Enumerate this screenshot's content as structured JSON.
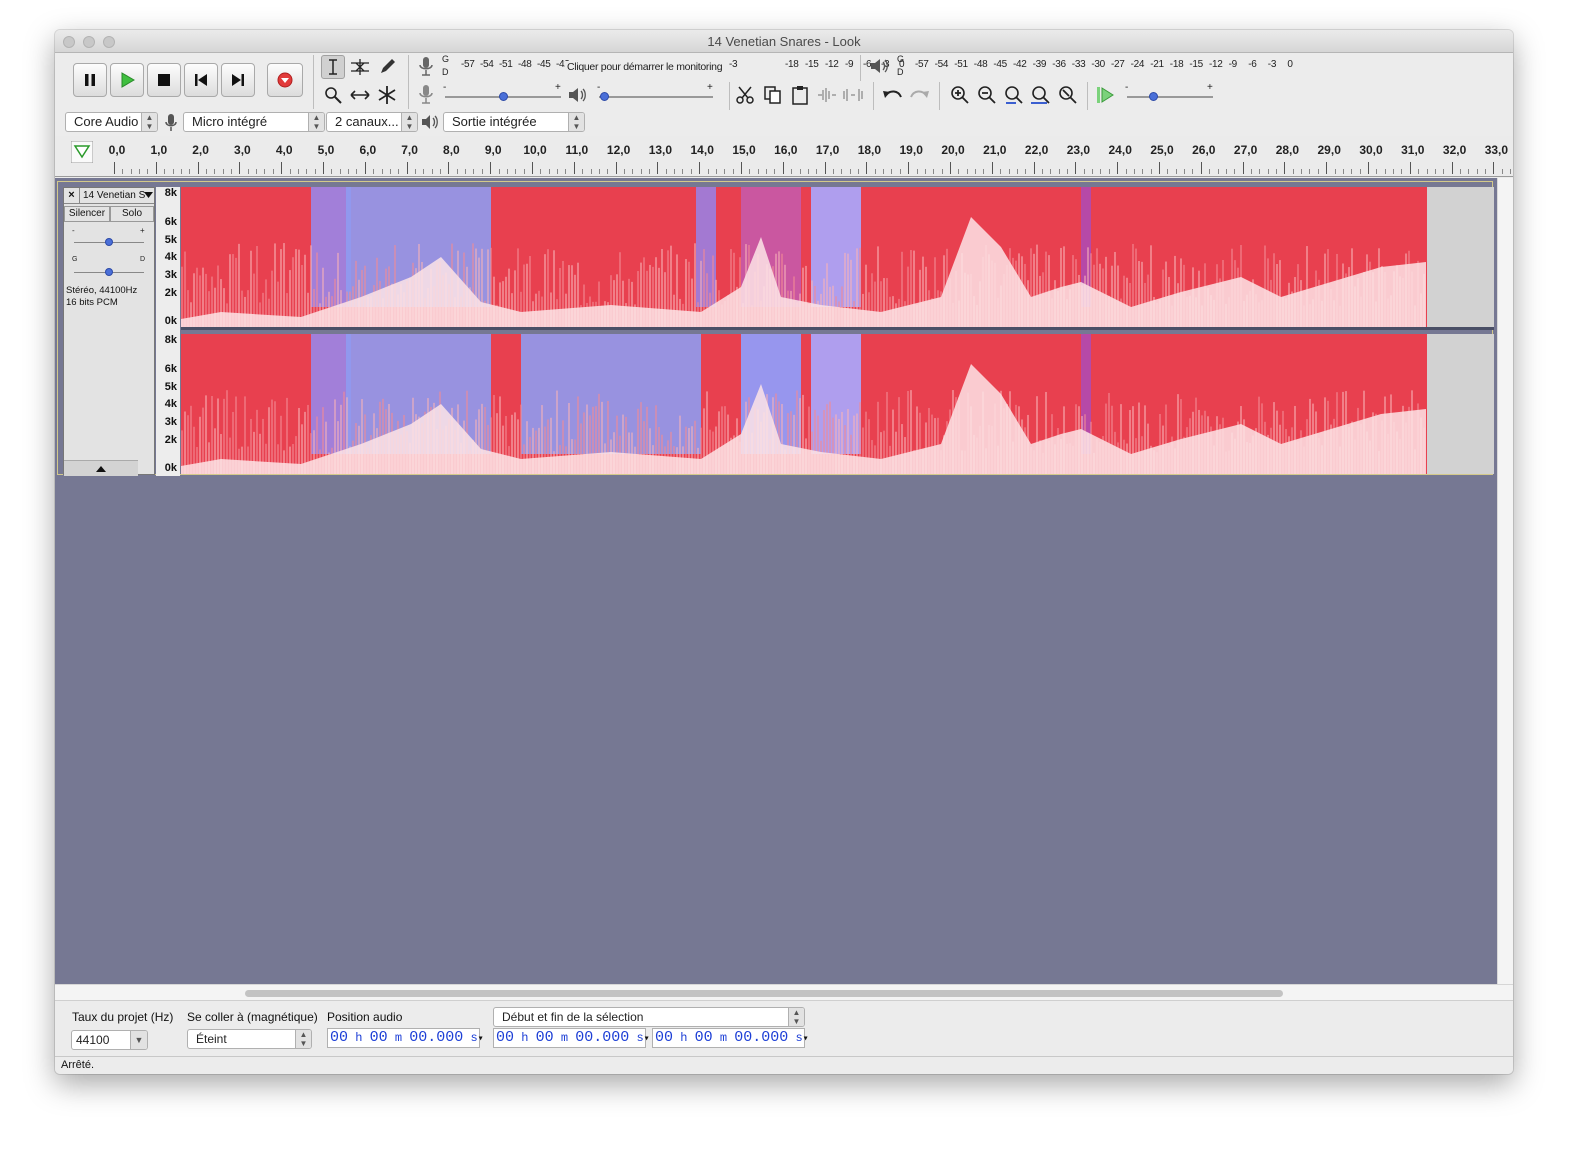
{
  "window": {
    "title": "14 Venetian Snares - Look"
  },
  "transport": {
    "pause": "pause-icon",
    "play": "play-icon",
    "stop": "stop-icon",
    "skip_start": "skip-to-start-icon",
    "skip_end": "skip-to-end-icon",
    "record": "record-icon"
  },
  "meters": {
    "record_channels": [
      "G",
      "D"
    ],
    "record_scale": [
      "-57",
      "-54",
      "-51",
      "-48",
      "-45",
      "-42",
      "-3",
      "-18",
      "-15",
      "-12",
      "-9",
      "-6",
      "-3",
      "0"
    ],
    "record_hint": "Cliquer pour démarrer le monitoring",
    "playback_channels": [
      "G",
      "D"
    ],
    "playback_scale": [
      "-57",
      "-54",
      "-51",
      "-48",
      "-45",
      "-42",
      "-39",
      "-36",
      "-33",
      "-30",
      "-27",
      "-24",
      "-21",
      "-18",
      "-15",
      "-12",
      "-9",
      "-6",
      "-3",
      "0"
    ],
    "slider_minus": "-",
    "slider_plus": "+",
    "play_speed_minus": "-",
    "play_speed_plus": "+"
  },
  "device": {
    "host": "Core Audio",
    "input": "Micro intégré",
    "channels": "2 canaux...",
    "output": "Sortie intégrée"
  },
  "ruler": {
    "ticks": [
      "0,0",
      "1,0",
      "2,0",
      "3,0",
      "4,0",
      "5,0",
      "6,0",
      "7,0",
      "8,0",
      "9,0",
      "10,0",
      "11,0",
      "12,0",
      "13,0",
      "14,0",
      "15,0",
      "16,0",
      "17,0",
      "18,0",
      "19,0",
      "20,0",
      "21,0",
      "22,0",
      "23,0",
      "24,0",
      "25,0",
      "26,0",
      "27,0",
      "28,0",
      "29,0",
      "30,0",
      "31,0",
      "32,0",
      "33,0"
    ]
  },
  "track": {
    "name": "14 Venetian S",
    "mute": "Silencer",
    "solo": "Solo",
    "gain_minus": "-",
    "gain_plus": "+",
    "pan_left": "G",
    "pan_right": "D",
    "info_line1": "Stéréo, 44100Hz",
    "info_line2": "16 bits PCM",
    "yaxis": [
      "8k",
      "6k",
      "5k",
      "4k",
      "3k",
      "2k",
      "0k"
    ]
  },
  "selection_bar": {
    "rate_label": "Taux du projet (Hz)",
    "rate_value": "44100",
    "snap_label": "Se coller à (magnétique)",
    "snap_value": "Éteint",
    "pos_label": "Position audio",
    "sel_mode": "Début et fin de la sélection",
    "time_h": "00",
    "time_m": "00",
    "time_s": "00.000",
    "unit_h": "h",
    "unit_m": "m",
    "unit_s": "s"
  },
  "status": "Arrêté."
}
